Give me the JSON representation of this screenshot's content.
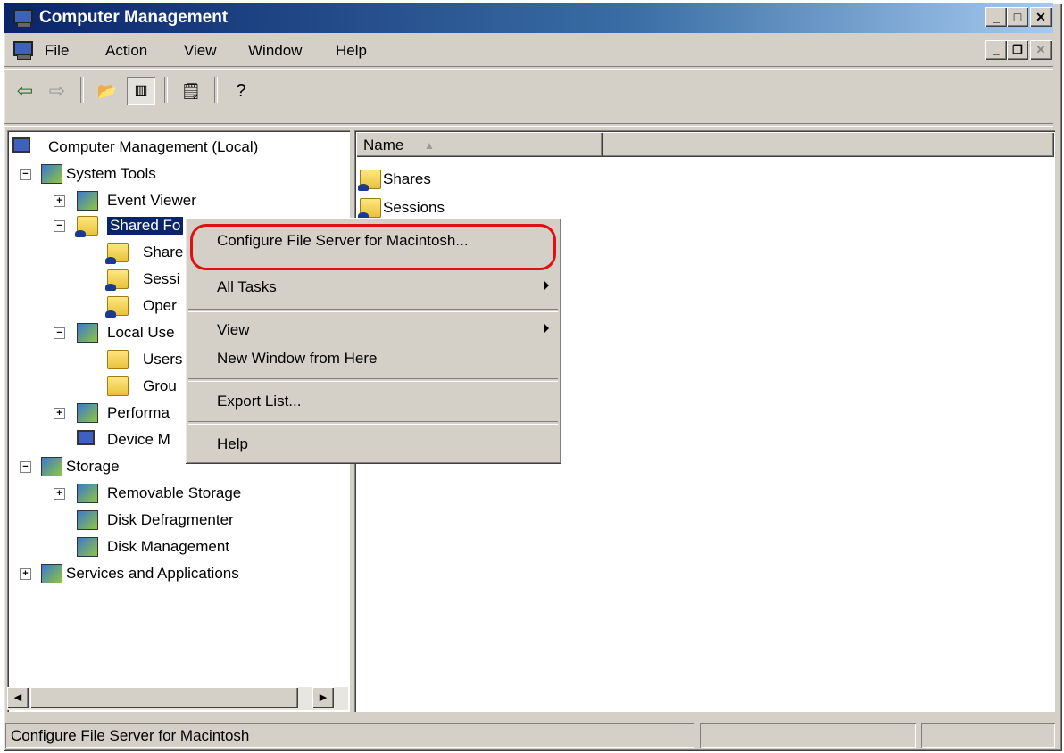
{
  "window": {
    "title": "Computer Management"
  },
  "menubar": {
    "items": [
      {
        "label": "File"
      },
      {
        "label": "Action"
      },
      {
        "label": "View"
      },
      {
        "label": "Window"
      },
      {
        "label": "Help"
      }
    ]
  },
  "tree": {
    "root": "Computer Management (Local)",
    "system_tools": "System Tools",
    "event_viewer": "Event Viewer",
    "shared_folders": "Shared Fo",
    "shares": "Share",
    "sessions": "Sessi",
    "open_files": "Oper",
    "local_users": "Local Use",
    "users": "Users",
    "groups": "Grou",
    "performance": "Performa",
    "device_manager": "Device M",
    "storage": "Storage",
    "removable_storage": "Removable Storage",
    "disk_defrag": "Disk Defragmenter",
    "disk_management": "Disk Management",
    "services": "Services and Applications"
  },
  "list": {
    "column_name": "Name",
    "items": [
      {
        "label": "Shares"
      },
      {
        "label": "Sessions"
      }
    ]
  },
  "context_menu": {
    "items": [
      {
        "label": "Configure File Server for Macintosh..."
      },
      {
        "label": "All Tasks"
      },
      {
        "label": "View"
      },
      {
        "label": "New Window from Here"
      },
      {
        "label": "Export List..."
      },
      {
        "label": "Help"
      }
    ]
  },
  "statusbar": {
    "text": "Configure File Server for Macintosh"
  },
  "colors": {
    "title_start": "#0a246a",
    "title_end": "#a6caf0",
    "highlight_ring": "#e01010",
    "selection": "#0a246a"
  }
}
